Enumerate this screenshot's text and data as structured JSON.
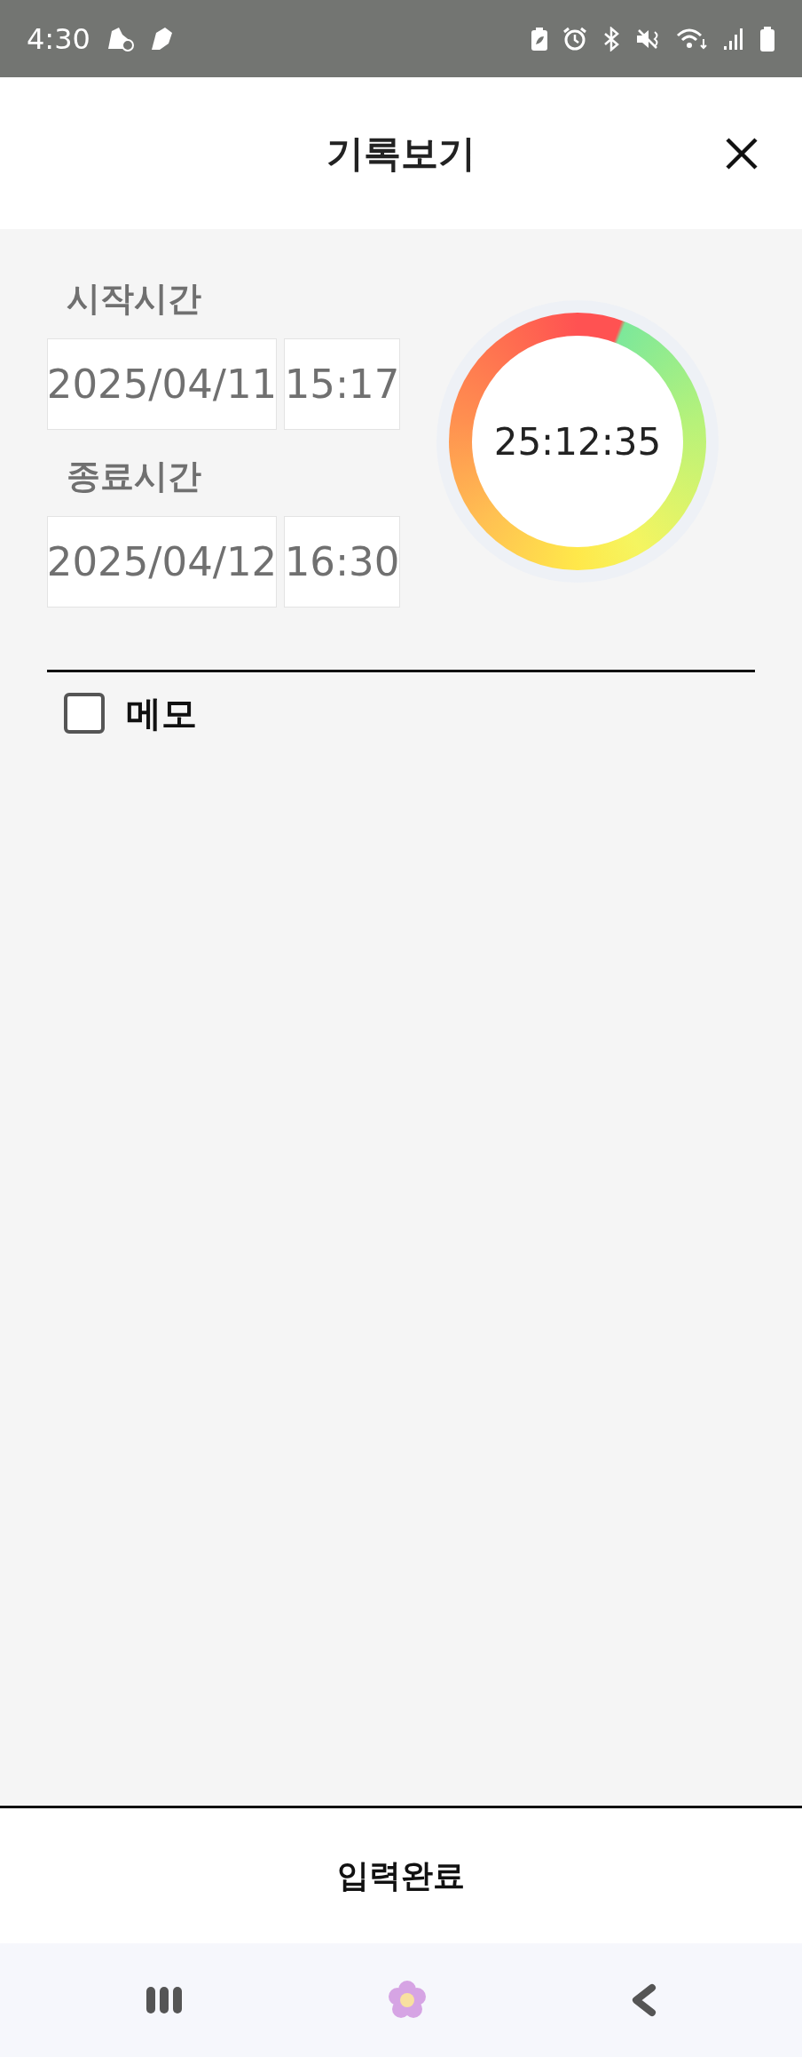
{
  "status_bar": {
    "time": "4:30"
  },
  "header": {
    "title": "기록보기"
  },
  "start": {
    "label": "시작시간",
    "date": "2025/04/11",
    "time": "15:17"
  },
  "end": {
    "label": "종료시간",
    "date": "2025/04/12",
    "time": "16:30"
  },
  "timer": {
    "elapsed": "25:12:35"
  },
  "memo": {
    "label": "메모",
    "checked": false
  },
  "submit_button": {
    "label": "입력완료"
  }
}
